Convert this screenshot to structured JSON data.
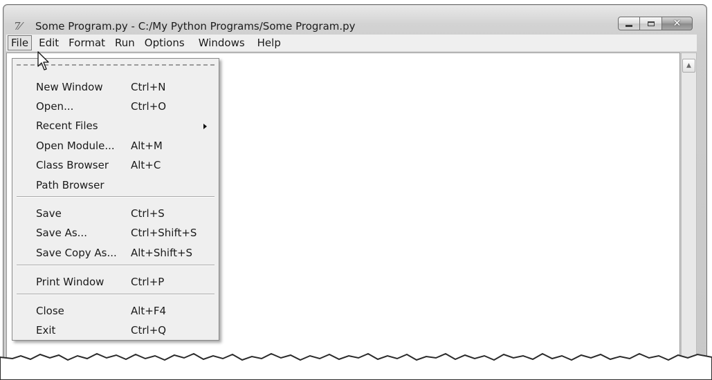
{
  "window": {
    "icon_glyph": "7⁄",
    "title": "Some Program.py - C:/My Python Programs/Some Program.py",
    "buttons": {
      "minimize": "minimize-icon",
      "maximize": "maximize-icon",
      "close": "close-icon"
    }
  },
  "menubar": {
    "items": [
      "File",
      "Edit",
      "Format",
      "Run",
      "Options",
      "Windows",
      "Help"
    ],
    "active": "File"
  },
  "file_menu": {
    "items": [
      {
        "label": "New Window",
        "accel": "Ctrl+N"
      },
      {
        "label": "Open...",
        "accel": "Ctrl+O"
      },
      {
        "label": "Recent Files",
        "accel": "",
        "submenu": true
      },
      {
        "label": "Open Module...",
        "accel": "Alt+M"
      },
      {
        "label": "Class Browser",
        "accel": "Alt+C"
      },
      {
        "label": "Path Browser",
        "accel": ""
      },
      {
        "label": "Save",
        "accel": "Ctrl+S"
      },
      {
        "label": "Save As...",
        "accel": "Ctrl+Shift+S"
      },
      {
        "label": "Save Copy As...",
        "accel": "Alt+Shift+S"
      },
      {
        "label": "Print Window",
        "accel": "Ctrl+P"
      },
      {
        "label": "Close",
        "accel": "Alt+F4"
      },
      {
        "label": "Exit",
        "accel": "Ctrl+Q"
      }
    ]
  },
  "colors": {
    "menu_bg": "#efefef",
    "frame": "#cdcdcd",
    "text": "#1a1a1a"
  }
}
